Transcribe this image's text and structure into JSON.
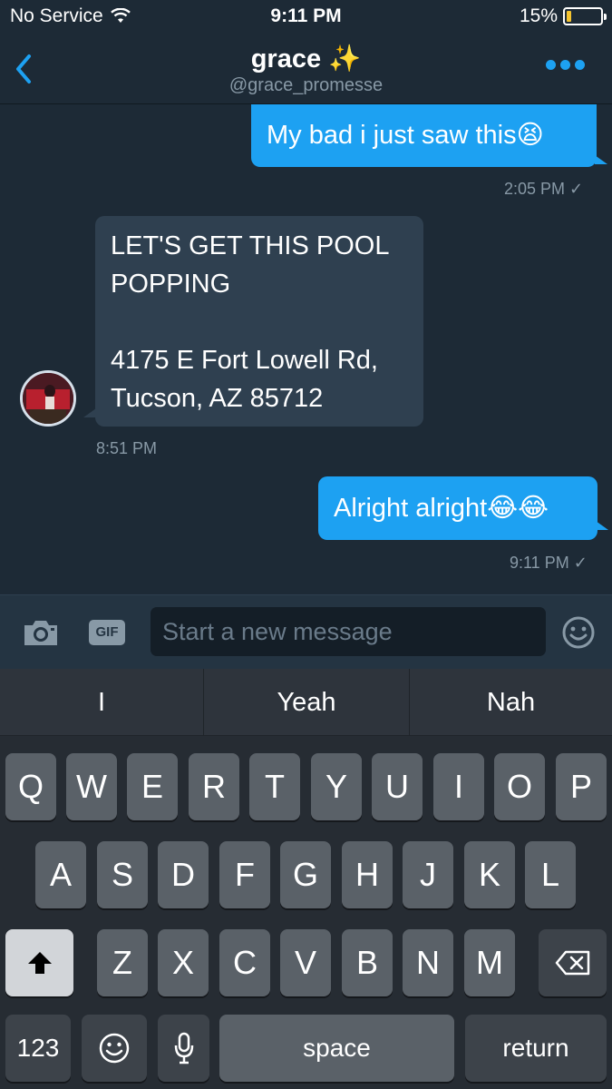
{
  "status_bar": {
    "carrier": "No Service",
    "time": "9:11 PM",
    "battery_percent": "15%",
    "battery_level": 0.15,
    "wifi_icon": "wifi-icon"
  },
  "header": {
    "title": "grace ✨",
    "handle": "@grace_promesse",
    "back_icon": "chevron-left-icon",
    "more_icon": "more-dots-icon"
  },
  "messages": [
    {
      "direction": "out",
      "text": "My bad i just saw this😫",
      "time": "2:05 PM ✓"
    },
    {
      "direction": "in",
      "text": "LET'S GET THIS POOL\nPOPPING\n\n4175 E Fort Lowell Rd,\nTucson, AZ 85712",
      "time": "8:51 PM"
    },
    {
      "direction": "out",
      "text": "Alright alright😂😂",
      "time": "9:11 PM ✓"
    }
  ],
  "composer": {
    "placeholder": "Start a new message",
    "gif_label": "GIF",
    "camera_icon": "camera-icon",
    "emoji_icon": "emoji-icon"
  },
  "keyboard": {
    "suggestions": [
      "I",
      "Yeah",
      "Nah"
    ],
    "row1": [
      "Q",
      "W",
      "E",
      "R",
      "T",
      "Y",
      "U",
      "I",
      "O",
      "P"
    ],
    "row2": [
      "A",
      "S",
      "D",
      "F",
      "G",
      "H",
      "J",
      "K",
      "L"
    ],
    "row3": [
      "Z",
      "X",
      "C",
      "V",
      "B",
      "N",
      "M"
    ],
    "numbers_label": "123",
    "space_label": "space",
    "return_label": "return",
    "shift_icon": "shift-icon",
    "backspace_icon": "backspace-icon",
    "emoji_key_icon": "emoji-icon",
    "mic_icon": "microphone-icon"
  },
  "colors": {
    "accent": "#1da1f2",
    "background": "#1d2a36",
    "incoming_bubble": "#2f4050",
    "muted_text": "#8899a6"
  }
}
